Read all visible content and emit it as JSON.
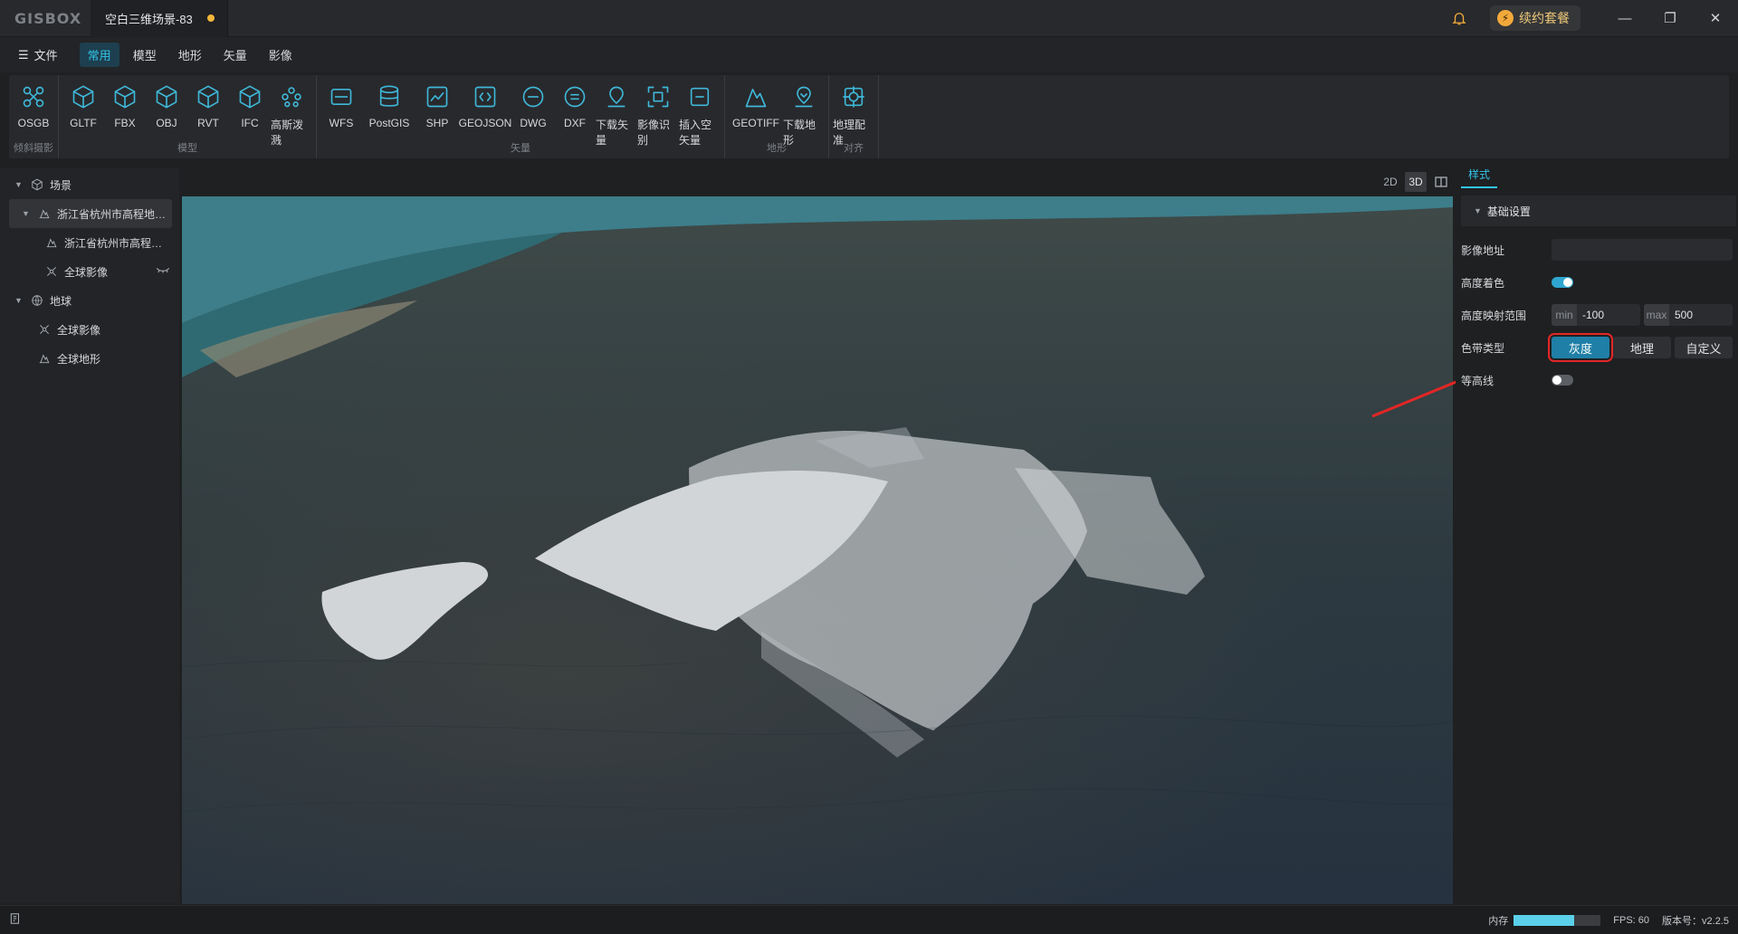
{
  "titlebar": {
    "logo": "GISBOX",
    "doc_title": "空白三维场景-83",
    "renew_label": "续约套餐",
    "window_buttons": [
      "minimize-icon",
      "restore-icon",
      "close-icon"
    ]
  },
  "menubar": {
    "file_label": "文件",
    "tabs": [
      {
        "label": "常用",
        "active": true
      },
      {
        "label": "模型",
        "active": false
      },
      {
        "label": "地形",
        "active": false
      },
      {
        "label": "矢量",
        "active": false
      },
      {
        "label": "影像",
        "active": false
      }
    ]
  },
  "ribbon": {
    "groups": [
      {
        "label": "倾斜摄影",
        "items": [
          {
            "label": "OSGB",
            "icon": "osgb-icon"
          }
        ]
      },
      {
        "label": "模型",
        "items": [
          {
            "label": "GLTF",
            "icon": "cube-icon"
          },
          {
            "label": "FBX",
            "icon": "cube-icon"
          },
          {
            "label": "OBJ",
            "icon": "cube-icon"
          },
          {
            "label": "RVT",
            "icon": "cube-icon"
          },
          {
            "label": "IFC",
            "icon": "cube-icon"
          },
          {
            "label": "高斯泼溅",
            "icon": "gaussian-icon"
          }
        ]
      },
      {
        "label": "矢量",
        "items": [
          {
            "label": "WFS",
            "icon": "wfs-icon"
          },
          {
            "label": "PostGIS",
            "icon": "database-icon"
          },
          {
            "label": "SHP",
            "icon": "shp-icon"
          },
          {
            "label": "GEOJSON",
            "icon": "geojson-icon"
          },
          {
            "label": "DWG",
            "icon": "dwg-icon"
          },
          {
            "label": "DXF",
            "icon": "dxf-icon"
          },
          {
            "label": "下载矢量",
            "icon": "download-vector-icon"
          },
          {
            "label": "影像识别",
            "icon": "image-recognition-icon"
          },
          {
            "label": "插入空矢量",
            "icon": "insert-vector-icon"
          }
        ]
      },
      {
        "label": "地形",
        "items": [
          {
            "label": "GEOTIFF",
            "icon": "geotiff-icon"
          },
          {
            "label": "下载地形",
            "icon": "download-terrain-icon"
          }
        ]
      },
      {
        "label": "对齐",
        "items": [
          {
            "label": "地理配准",
            "icon": "georeference-icon"
          }
        ]
      }
    ]
  },
  "tree": {
    "scene_label": "场景",
    "scene_children": [
      {
        "label": "浙江省杭州市高程地…",
        "icon": "terrain-icon",
        "level": 1,
        "selected": true
      },
      {
        "label": "浙江省杭州市高程…",
        "icon": "terrain-icon",
        "level": 2
      },
      {
        "label": "全球影像",
        "icon": "imagery-icon",
        "level": 2,
        "eye": "eye-off-icon"
      }
    ],
    "globe_label": "地球",
    "globe_children": [
      {
        "label": "全球影像",
        "icon": "imagery-icon"
      },
      {
        "label": "全球地形",
        "icon": "terrain-icon"
      }
    ]
  },
  "view_mode": {
    "options": [
      "2D",
      "3D",
      "split-view-icon"
    ],
    "active": "3D"
  },
  "right_panel": {
    "tab_label": "样式",
    "section_label": "基础设置",
    "image_url_label": "影像地址",
    "image_url_value": "",
    "height_color_label": "高度着色",
    "height_color_on": true,
    "range_label": "高度映射范围",
    "min_prefix": "min",
    "min_value": "-100",
    "max_prefix": "max",
    "max_value": "500",
    "ribbon_type_label": "色带类型",
    "ribbon_types": [
      {
        "label": "灰度",
        "active": true
      },
      {
        "label": "地理",
        "active": false
      },
      {
        "label": "自定义",
        "active": false
      }
    ],
    "contour_label": "等高线",
    "contour_on": false
  },
  "statusbar": {
    "memory_label": "内存",
    "memory_usage": 0.7,
    "fps_text": "FPS: 60",
    "version_text": "版本号：v2.2.5"
  },
  "colors": {
    "accent": "#33c4e8",
    "selected_btn": "#1f7fa6",
    "highlight_box": "#e32626",
    "arrow": "#e32626"
  }
}
